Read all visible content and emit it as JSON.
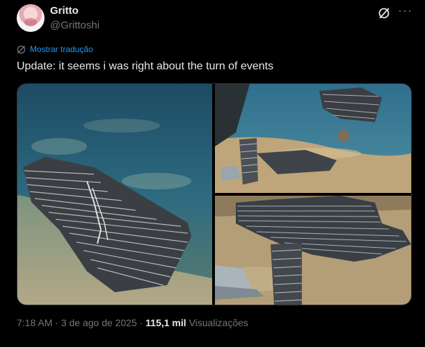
{
  "author": {
    "display_name": "Gritto",
    "handle": "@Grittoshi",
    "avatar_icon": "anime-avatar"
  },
  "header_actions": {
    "grok_icon": "grok-slash-icon",
    "more_icon": "more-horizontal-icon",
    "more_label": "···"
  },
  "translate": {
    "icon": "globe-icon",
    "label": "Mostrar tradução"
  },
  "tweet": {
    "text": "Update: it seems i was right about the turn of events"
  },
  "media": {
    "count": 3,
    "photos": [
      "sculpture-in-water-photo",
      "sculpture-on-shore-photo",
      "sculpture-closeup-photo"
    ]
  },
  "meta": {
    "time": "7:18 AM",
    "separator": "·",
    "date": "3 de ago de 2025",
    "separator2": "·",
    "views_count": "115,1 mil",
    "views_label": "Visualizações"
  },
  "colors": {
    "background": "#000000",
    "text": "#e7e9ea",
    "secondary": "#71767b",
    "link": "#1d9bf0"
  }
}
